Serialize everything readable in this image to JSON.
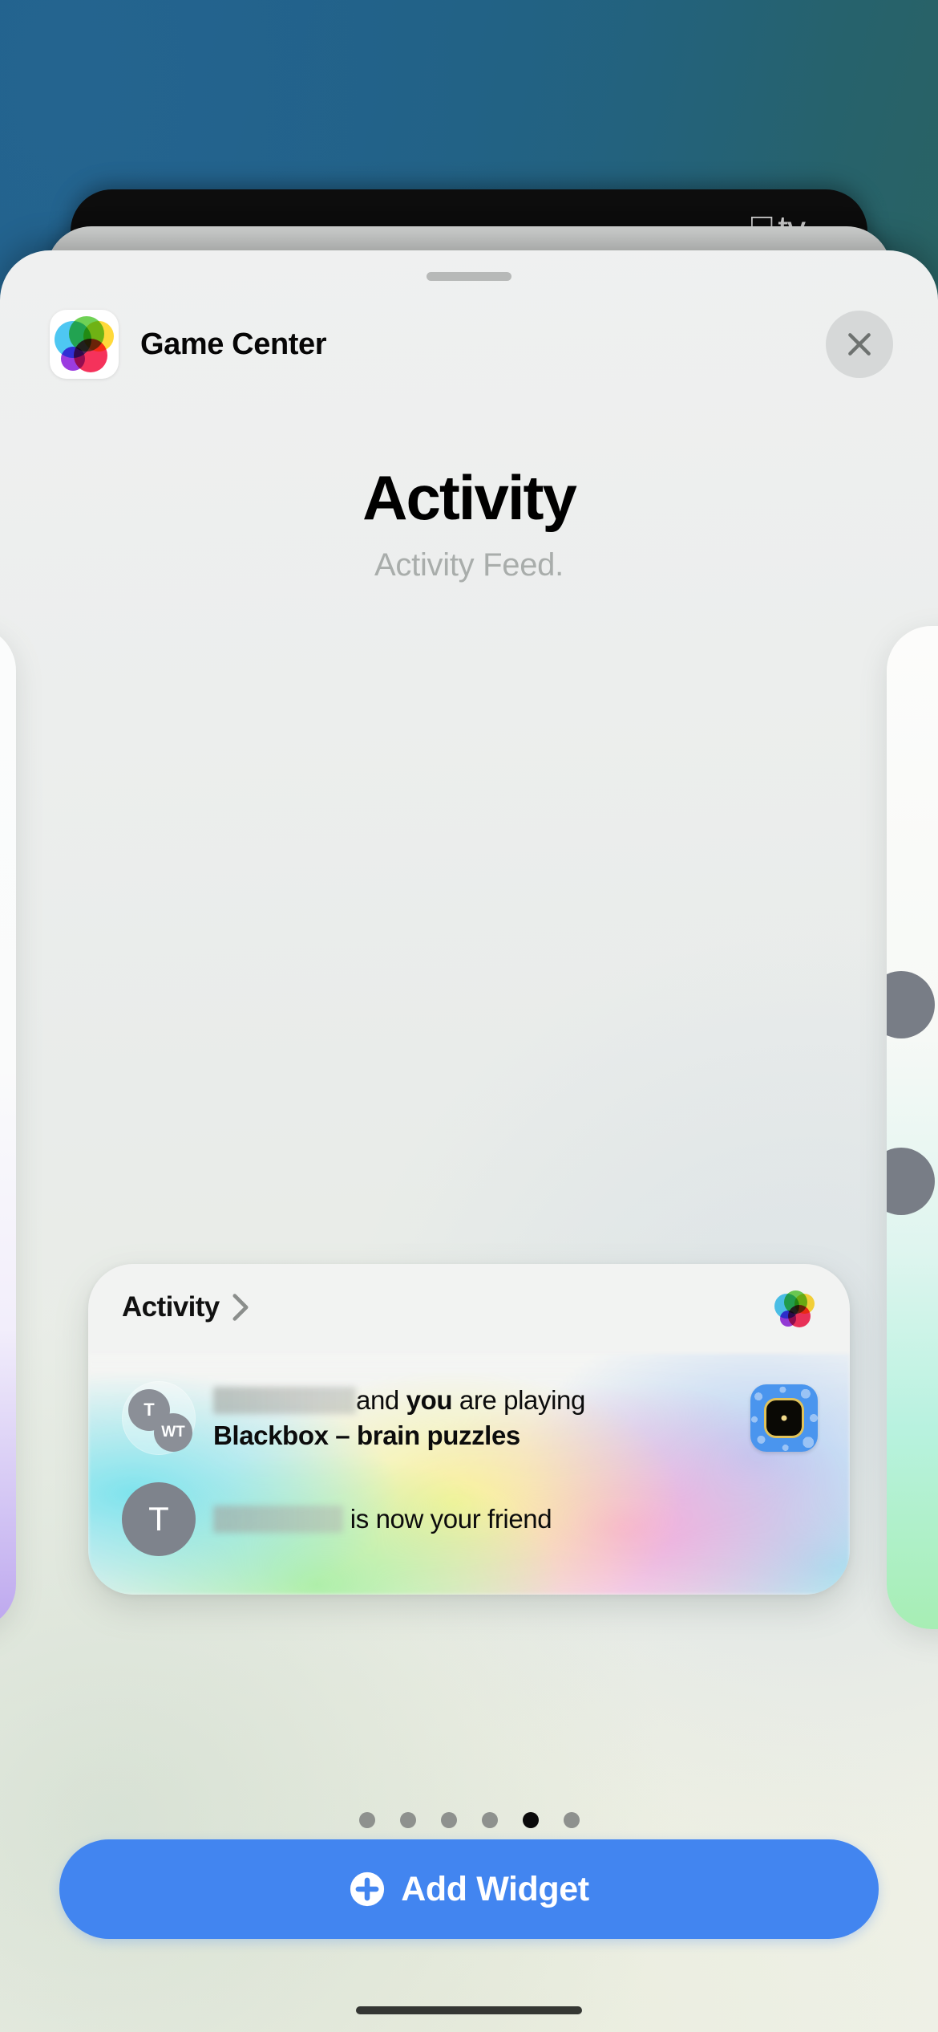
{
  "background": {
    "gradient_from": "#1d5e8e",
    "gradient_to": "#2e6257"
  },
  "behind_cards": {
    "apple_tv": {
      "apple_glyph": "",
      "label": "tv",
      "background": "#0d0d0d"
    },
    "grey_card": {
      "background": "#cfd1d0"
    }
  },
  "sheet": {
    "grabber": "drag-handle",
    "header": {
      "app_icon": "game-center-icon",
      "app_name": "Game Center",
      "close_label": "Close"
    },
    "title": "Activity",
    "subtitle": "Activity Feed."
  },
  "widget_preview": {
    "header_label": "Activity",
    "header_chevron": "chevron-right-icon",
    "brand_icon": "game-center-icon",
    "accent_colors": {
      "cyan": "#78e2ec",
      "green": "#a7eea3",
      "yellow": "#f9f594",
      "pink": "#f7a3d8",
      "blue": "#afcdf5"
    },
    "feed": [
      {
        "avatar_type": "group",
        "avatar_initials": [
          "T",
          "WT"
        ],
        "redacted_name": true,
        "text_before": "",
        "text_mid_1": "and",
        "text_strong": "you",
        "text_mid_2": "are playing",
        "game_title": "Blackbox – brain puzzles",
        "app_icon": "blackbox-app-icon"
      },
      {
        "avatar_type": "single",
        "avatar_initials": [
          "T"
        ],
        "redacted_name": true,
        "text_after": "is now your friend"
      }
    ]
  },
  "pagination": {
    "total": 6,
    "active_index": 4
  },
  "footer": {
    "add_widget_label": "Add Widget",
    "add_widget_icon": "plus-circle-icon",
    "button_color": "#4285f0"
  }
}
